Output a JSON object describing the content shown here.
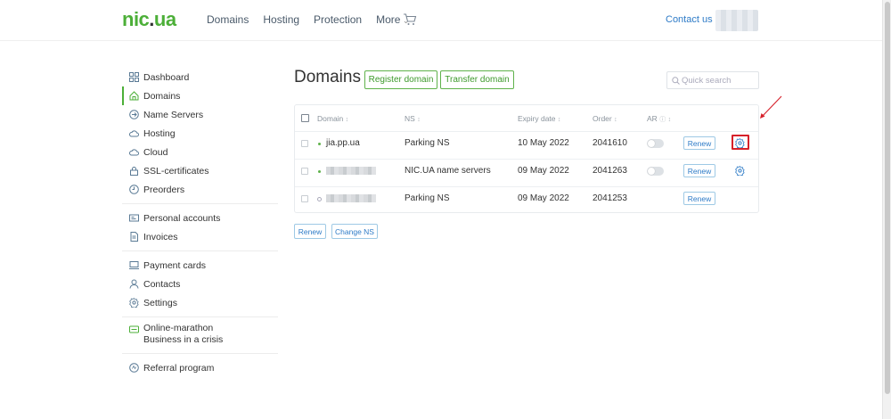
{
  "header": {
    "logo_main": "nic",
    "logo_dot": ".",
    "logo_tld": "ua",
    "nav": [
      "Domains",
      "Hosting",
      "Protection",
      "More"
    ],
    "cart_icon": "cart-icon",
    "contact": "Contact us"
  },
  "sidebar": {
    "groups": [
      [
        {
          "label": "Dashboard",
          "icon": "dashboard-icon"
        },
        {
          "label": "Domains",
          "icon": "home-icon",
          "active": true
        },
        {
          "label": "Name Servers",
          "icon": "arrow-right-circle-icon"
        },
        {
          "label": "Hosting",
          "icon": "cloud-icon"
        },
        {
          "label": "Cloud",
          "icon": "cloud-icon"
        },
        {
          "label": "SSL-certificates",
          "icon": "lock-icon"
        },
        {
          "label": "Preorders",
          "icon": "clock-icon"
        }
      ],
      [
        {
          "label": "Personal accounts",
          "icon": "id-card-icon"
        },
        {
          "label": "Invoices",
          "icon": "document-icon"
        }
      ],
      [
        {
          "label": "Payment cards",
          "icon": "laptop-card-icon"
        },
        {
          "label": "Contacts",
          "icon": "person-icon"
        },
        {
          "label": "Settings",
          "icon": "gear-icon"
        }
      ]
    ],
    "marathon_line1": "Online-marathon",
    "marathon_line2": "Business in a crisis",
    "referral": "Referral program"
  },
  "main": {
    "title": "Domains",
    "register_button": "Register domain",
    "transfer_button": "Transfer domain",
    "search_placeholder": "Quick search",
    "columns": {
      "domain": "Domain",
      "ns": "NS",
      "expiry": "Expiry date",
      "order": "Order",
      "ar": "AR"
    },
    "rows": [
      {
        "domain": "jia.pp.ua",
        "ns": "Parking NS",
        "expiry": "10 May 2022",
        "order": "2041610",
        "renew": "Renew"
      },
      {
        "domain": "",
        "ns": "NIC.UA name servers",
        "expiry": "09 May 2022",
        "order": "2041263",
        "renew": "Renew"
      },
      {
        "domain": "",
        "ns": "Parking NS",
        "expiry": "09 May 2022",
        "order": "2041253",
        "renew": "Renew"
      }
    ],
    "bulk_renew": "Renew",
    "bulk_change_ns": "Change NS"
  },
  "colors": {
    "brand_green": "#4caf38",
    "link_blue": "#2e7bc7",
    "highlight_red": "#d6202a"
  }
}
